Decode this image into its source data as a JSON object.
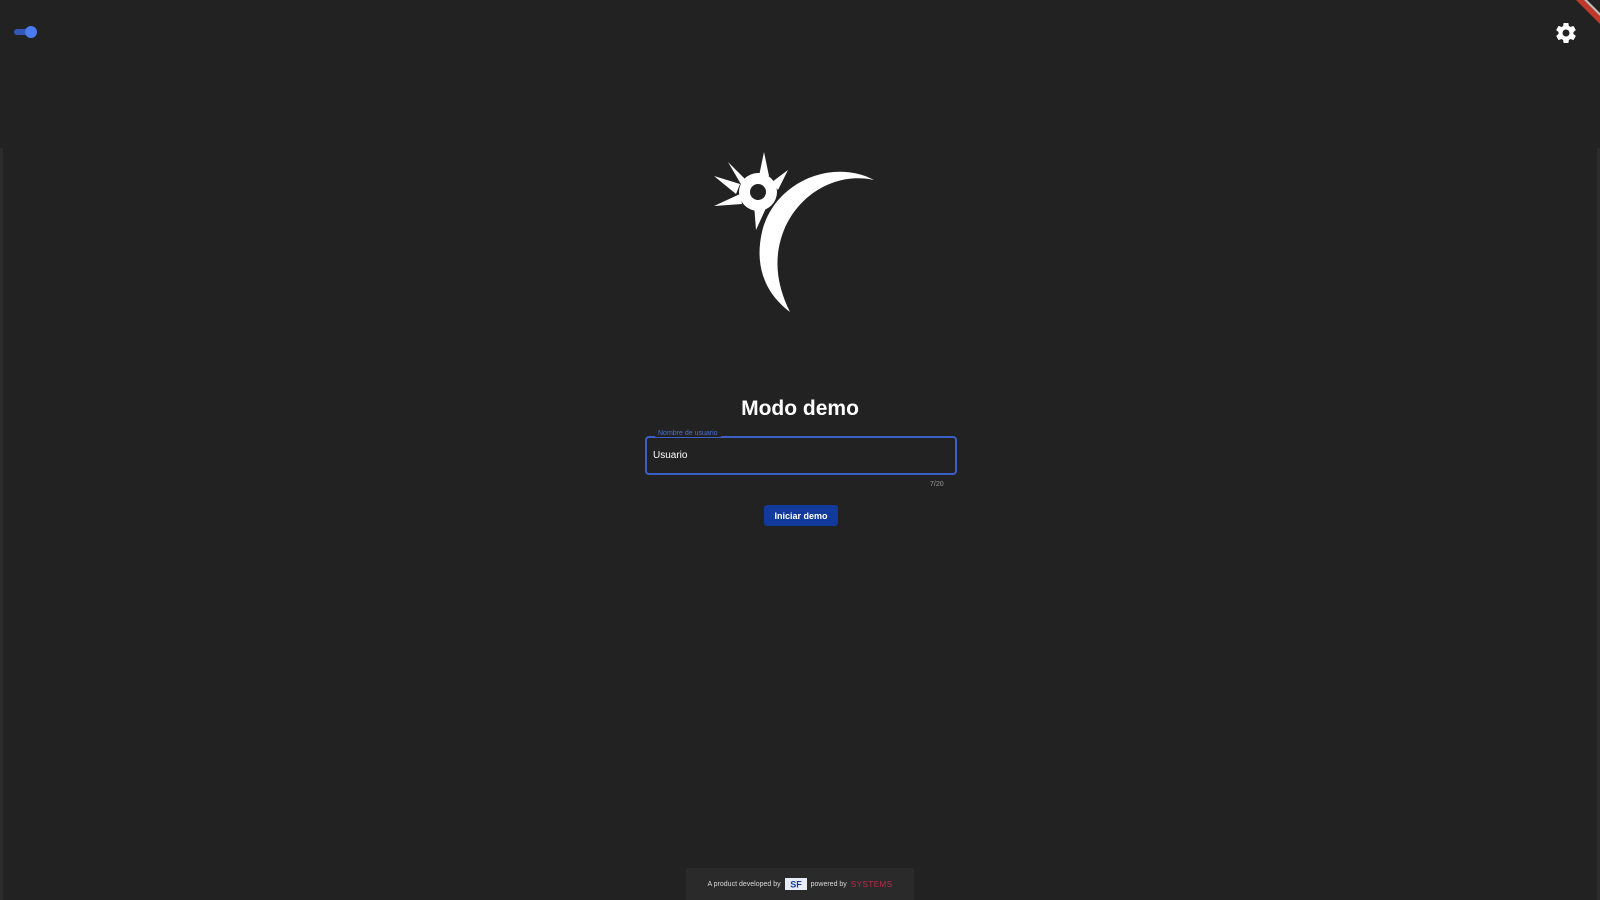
{
  "header": {
    "theme_toggle": {
      "state": "on",
      "color": "#4b7bf0"
    },
    "settings": {
      "icon": "gear-icon"
    }
  },
  "logo": {
    "icon": "star-crescent-logo"
  },
  "main": {
    "title": "Modo demo",
    "field": {
      "label": "Nombre de usuario",
      "value": "Usuario",
      "counter": "7/20"
    },
    "start_button_label": "Iniciar demo"
  },
  "footer": {
    "developed_text": "A product developed by",
    "developer_logo_text": "SF",
    "powered_text": "powered by",
    "powered_logo_text": "SYSTEMS"
  },
  "colors": {
    "background": "#222222",
    "accent": "#3b5fc7",
    "button": "#123a9c",
    "ribbon": "#c0392b"
  }
}
